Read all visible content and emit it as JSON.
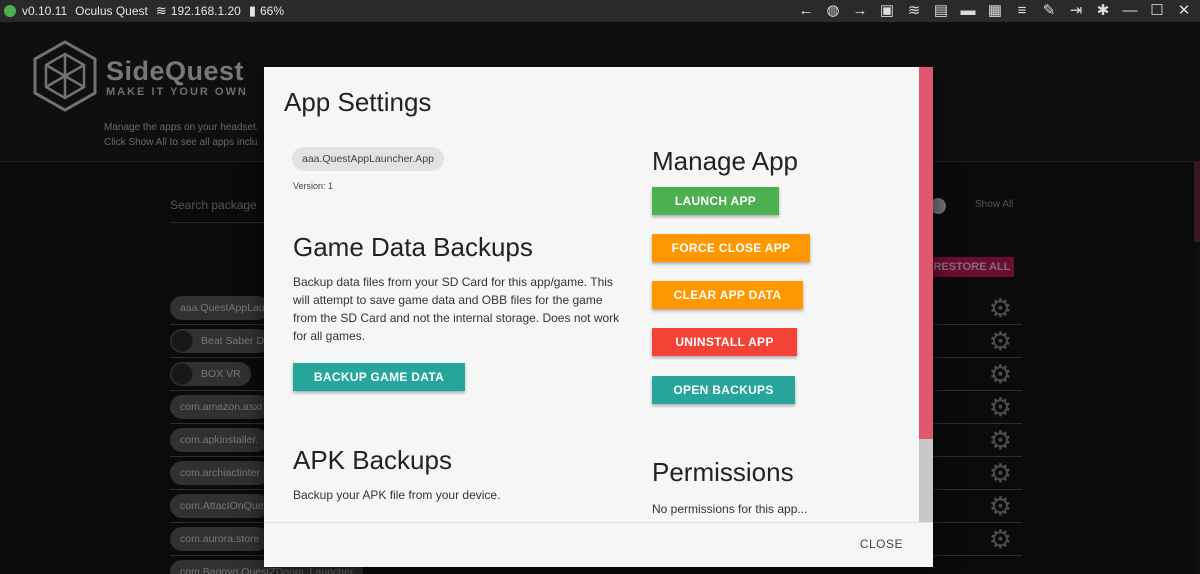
{
  "topbar": {
    "version": "v0.10.11",
    "device": "Oculus Quest",
    "ip": "192.168.1.20",
    "battery": "66%",
    "status_color": "#4caf50",
    "icons": [
      "back-arrow-icon",
      "globe-icon",
      "forward-arrow-icon",
      "media-icon",
      "wifi-icon",
      "backup-icon",
      "folder-icon",
      "grid-icon",
      "list-check-icon",
      "wrench-icon",
      "exit-icon",
      "bug-icon",
      "minimize-icon",
      "maximize-icon",
      "close-icon"
    ]
  },
  "background": {
    "logo_title": "SideQuest",
    "logo_subtitle": "MAKE IT YOUR OWN",
    "desc_line1": "Manage the apps on your headset.",
    "desc_line2": "Click Show All to see all apps inclu",
    "search_placeholder": "Search package",
    "show_all_label": "Show All",
    "restore_all_label": "RESTORE ALL",
    "packages": [
      {
        "label": "aaa.QuestAppLau",
        "has_thumb": false
      },
      {
        "label": "Beat Saber D",
        "has_thumb": true
      },
      {
        "label": "BOX VR",
        "has_thumb": true
      },
      {
        "label": "com.amazon.asxr",
        "has_thumb": false
      },
      {
        "label": "com.apkinstaller.",
        "has_thumb": false
      },
      {
        "label": "com.archiactinter",
        "has_thumb": false
      },
      {
        "label": "com.AttacIOnQue",
        "has_thumb": false
      },
      {
        "label": "com.aurora.store",
        "has_thumb": false
      },
      {
        "label": "com.Baggyg.QuestZDoom_Launcher",
        "has_thumb": false
      }
    ]
  },
  "modal": {
    "title": "App Settings",
    "package_name": "aaa.QuestAppLauncher.App",
    "version": "Version: 1",
    "game_data": {
      "title": "Game Data Backups",
      "description": "Backup data files from your SD Card for this app/game. This will attempt to save game data and OBB files for the game from the SD Card and not the internal storage. Does not work for all games.",
      "button": "BACKUP GAME DATA"
    },
    "apk": {
      "title": "APK Backups",
      "description": "Backup your APK file from your device."
    },
    "manage": {
      "title": "Manage App",
      "launch": "LAUNCH APP",
      "force_close": "FORCE CLOSE APP",
      "clear_data": "CLEAR APP DATA",
      "uninstall": "UNINSTALL APP",
      "open_backups": "OPEN BACKUPS"
    },
    "permissions": {
      "title": "Permissions",
      "text": "No permissions for this app..."
    },
    "close_label": "CLOSE"
  },
  "colors": {
    "teal": "#26a69a",
    "green": "#4caf50",
    "orange": "#ff9800",
    "red": "#f44336",
    "scroll_accent": "#e0576f",
    "restore_accent": "#c2185b"
  }
}
